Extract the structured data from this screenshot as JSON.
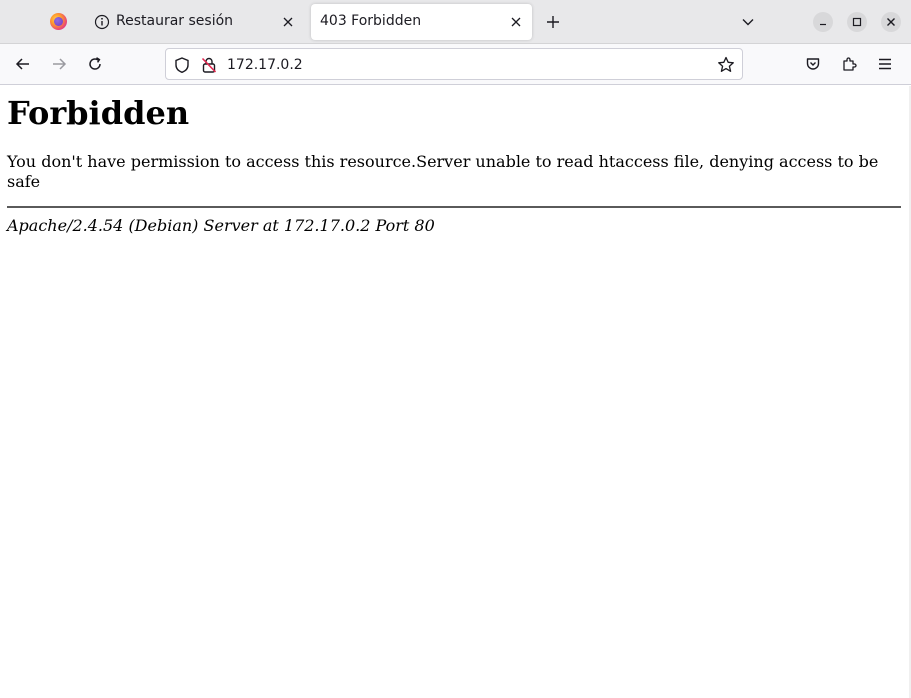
{
  "browser": {
    "tabs": [
      {
        "title": "Restaurar sesión",
        "icon": "info-icon",
        "active": false
      },
      {
        "title": "403 Forbidden",
        "icon": "",
        "active": true
      }
    ],
    "url": "172.17.0.2"
  },
  "page": {
    "heading": "Forbidden",
    "message": "You don't have permission to access this resource.Server unable to read htaccess file, denying access to be safe",
    "footer": "Apache/2.4.54 (Debian) Server at 172.17.0.2 Port 80"
  }
}
